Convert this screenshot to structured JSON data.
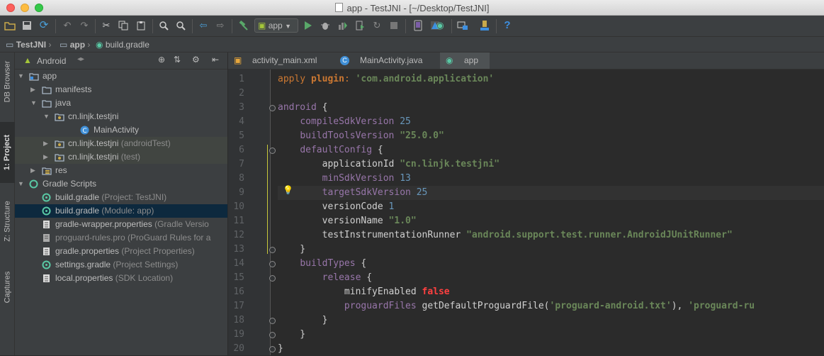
{
  "window": {
    "title": "app - TestJNI - [~/Desktop/TestJNI]"
  },
  "toolbar": {
    "run_config": "app"
  },
  "breadcrumb": [
    "TestJNI",
    "app",
    "build.gradle"
  ],
  "project_panel": {
    "view_mode": "Android"
  },
  "side_tabs": [
    "DB Browser",
    "1: Project",
    "Z: Structure",
    "Captures"
  ],
  "tree": [
    {
      "label": "app",
      "hint": "",
      "level": 0,
      "arrow": "down",
      "icon": "module-folder-icon"
    },
    {
      "label": "manifests",
      "hint": "",
      "level": 1,
      "arrow": "right",
      "icon": "folder-icon"
    },
    {
      "label": "java",
      "hint": "",
      "level": 1,
      "arrow": "down",
      "icon": "folder-icon"
    },
    {
      "label": "cn.linjk.testjni",
      "hint": "",
      "level": 2,
      "arrow": "down",
      "icon": "package-icon"
    },
    {
      "label": "MainActivity",
      "hint": "",
      "level": 4,
      "arrow": "",
      "icon": "class-icon"
    },
    {
      "label": "cn.linjk.testjni",
      "hint": "(androidTest)",
      "level": 2,
      "arrow": "right",
      "icon": "package-icon"
    },
    {
      "label": "cn.linjk.testjni",
      "hint": "(test)",
      "level": 2,
      "arrow": "right",
      "icon": "package-icon"
    },
    {
      "label": "res",
      "hint": "",
      "level": 1,
      "arrow": "right",
      "icon": "res-folder-icon"
    },
    {
      "label": "Gradle Scripts",
      "hint": "",
      "level": 0,
      "arrow": "down",
      "icon": "gradle-icon"
    },
    {
      "label": "build.gradle",
      "hint": "(Project: TestJNI)",
      "level": 1,
      "arrow": "",
      "icon": "gradle-file-icon"
    },
    {
      "label": "build.gradle",
      "hint": "(Module: app)",
      "level": 1,
      "arrow": "",
      "icon": "gradle-file-icon",
      "selected": true
    },
    {
      "label": "gradle-wrapper.properties",
      "hint": "(Gradle Versio",
      "level": 1,
      "arrow": "",
      "icon": "properties-file-icon"
    },
    {
      "label": "proguard-rules.pro",
      "hint": "(ProGuard Rules for a",
      "level": 1,
      "arrow": "",
      "icon": "text-file-icon",
      "dim": true
    },
    {
      "label": "gradle.properties",
      "hint": "(Project Properties)",
      "level": 1,
      "arrow": "",
      "icon": "properties-file-icon"
    },
    {
      "label": "settings.gradle",
      "hint": "(Project Settings)",
      "level": 1,
      "arrow": "",
      "icon": "gradle-file-icon"
    },
    {
      "label": "local.properties",
      "hint": "(SDK Location)",
      "level": 1,
      "arrow": "",
      "icon": "properties-file-icon"
    }
  ],
  "editor_tabs": [
    {
      "label": "activity_main.xml",
      "icon": "xml-file-icon"
    },
    {
      "label": "MainActivity.java",
      "icon": "class-icon"
    },
    {
      "label": "app",
      "icon": "gradle-file-icon",
      "active": true
    }
  ],
  "code": [
    {
      "n": "1",
      "t": [
        {
          "c": "kw",
          "s": "apply "
        },
        {
          "c": "kwf",
          "s": "plugin"
        },
        {
          "c": "kw",
          "s": ": "
        },
        {
          "c": "str",
          "s": "'com.android.application'"
        }
      ]
    },
    {
      "n": "2",
      "t": []
    },
    {
      "n": "3",
      "t": [
        {
          "c": "prop",
          "s": "android "
        },
        {
          "c": "plain",
          "s": "{"
        }
      ]
    },
    {
      "n": "4",
      "t": [
        {
          "c": "plain",
          "s": "    "
        },
        {
          "c": "prop",
          "s": "compileSdkVersion "
        },
        {
          "c": "num",
          "s": "25"
        }
      ]
    },
    {
      "n": "5",
      "t": [
        {
          "c": "plain",
          "s": "    "
        },
        {
          "c": "prop",
          "s": "buildToolsVersion "
        },
        {
          "c": "str",
          "s": "\"25.0.0\""
        }
      ]
    },
    {
      "n": "6",
      "t": [
        {
          "c": "plain",
          "s": "    "
        },
        {
          "c": "prop",
          "s": "defaultConfig "
        },
        {
          "c": "plain",
          "s": "{"
        }
      ]
    },
    {
      "n": "7",
      "t": [
        {
          "c": "plain",
          "s": "        applicationId "
        },
        {
          "c": "str",
          "s": "\"cn.linjk.testjni\""
        }
      ]
    },
    {
      "n": "8",
      "t": [
        {
          "c": "plain",
          "s": "        "
        },
        {
          "c": "prop",
          "s": "minSdkVersion "
        },
        {
          "c": "num",
          "s": "13"
        }
      ]
    },
    {
      "n": "9",
      "t": [
        {
          "c": "plain",
          "s": "        "
        },
        {
          "c": "prop",
          "s": "targetSdkVersion "
        },
        {
          "c": "num",
          "s": "25"
        }
      ],
      "current": true
    },
    {
      "n": "10",
      "t": [
        {
          "c": "plain",
          "s": "        versionCode "
        },
        {
          "c": "num",
          "s": "1"
        }
      ]
    },
    {
      "n": "11",
      "t": [
        {
          "c": "plain",
          "s": "        versionName "
        },
        {
          "c": "str",
          "s": "\"1.0\""
        }
      ]
    },
    {
      "n": "12",
      "t": [
        {
          "c": "plain",
          "s": "        testInstrumentationRunner "
        },
        {
          "c": "str",
          "s": "\"android.support.test.runner.AndroidJUnitRunner\""
        }
      ]
    },
    {
      "n": "13",
      "t": [
        {
          "c": "plain",
          "s": "    }"
        }
      ]
    },
    {
      "n": "14",
      "t": [
        {
          "c": "plain",
          "s": "    "
        },
        {
          "c": "prop",
          "s": "buildTypes "
        },
        {
          "c": "plain",
          "s": "{"
        }
      ]
    },
    {
      "n": "15",
      "t": [
        {
          "c": "plain",
          "s": "        "
        },
        {
          "c": "prop",
          "s": "release "
        },
        {
          "c": "plain",
          "s": "{"
        }
      ]
    },
    {
      "n": "16",
      "t": [
        {
          "c": "plain",
          "s": "            minifyEnabled "
        },
        {
          "c": "kwf",
          "s": "false"
        }
      ]
    },
    {
      "n": "17",
      "t": [
        {
          "c": "plain",
          "s": "            "
        },
        {
          "c": "prop",
          "s": "proguardFiles "
        },
        {
          "c": "plain",
          "s": "getDefaultProguardFile("
        },
        {
          "c": "str",
          "s": "'proguard-android.txt'"
        },
        {
          "c": "plain",
          "s": "), "
        },
        {
          "c": "str",
          "s": "'proguard-ru"
        }
      ]
    },
    {
      "n": "18",
      "t": [
        {
          "c": "plain",
          "s": "        }"
        }
      ]
    },
    {
      "n": "19",
      "t": [
        {
          "c": "plain",
          "s": "    }"
        }
      ]
    },
    {
      "n": "20",
      "t": [
        {
          "c": "plain",
          "s": "}"
        }
      ]
    }
  ],
  "colors": {
    "keyword": "#cc7832",
    "string": "#6a8759",
    "number": "#6897bb",
    "property": "#9876aa",
    "false_keyword": "#ff4040",
    "selection": "#0d293e",
    "run_green": "#59a869",
    "help_blue": "#3d8fe0"
  }
}
